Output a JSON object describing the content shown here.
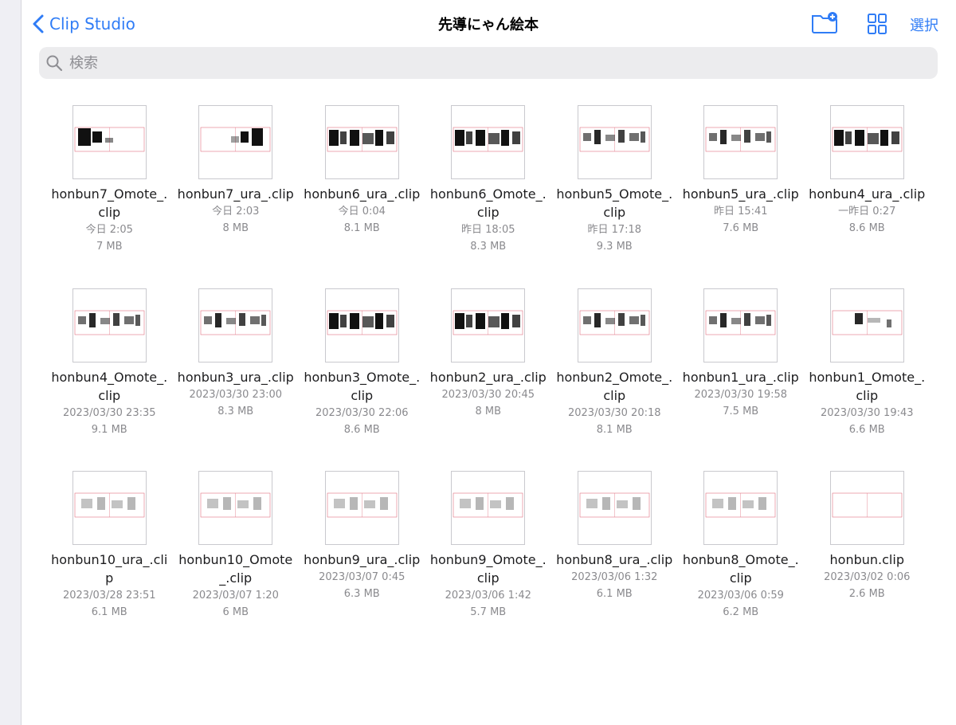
{
  "header": {
    "back_label": "Clip Studio",
    "title": "先導にゃん絵本",
    "select_label": "選択"
  },
  "search": {
    "placeholder": "検索",
    "value": ""
  },
  "files": [
    {
      "name": "honbun7_Omote_.clip",
      "date": "今日 2:05",
      "size": "7 MB",
      "thumb": "dark-left"
    },
    {
      "name": "honbun7_ura_.clip",
      "date": "今日 2:03",
      "size": "8 MB",
      "thumb": "dark-right"
    },
    {
      "name": "honbun6_ura_.clip",
      "date": "今日 0:04",
      "size": "8.1 MB",
      "thumb": "dense"
    },
    {
      "name": "honbun6_Omote_.clip",
      "date": "昨日 18:05",
      "size": "8.3 MB",
      "thumb": "dense"
    },
    {
      "name": "honbun5_Omote_.clip",
      "date": "昨日 17:18",
      "size": "9.3 MB",
      "thumb": "medium"
    },
    {
      "name": "honbun5_ura_.clip",
      "date": "昨日 15:41",
      "size": "7.6 MB",
      "thumb": "medium"
    },
    {
      "name": "honbun4_ura_.clip",
      "date": "一昨日 0:27",
      "size": "8.6 MB",
      "thumb": "dense"
    },
    {
      "name": "honbun4_Omote_.clip",
      "date": "2023/03/30 23:35",
      "size": "9.1 MB",
      "thumb": "medium"
    },
    {
      "name": "honbun3_ura_.clip",
      "date": "2023/03/30 23:00",
      "size": "8.3 MB",
      "thumb": "medium"
    },
    {
      "name": "honbun3_Omote_.clip",
      "date": "2023/03/30 22:06",
      "size": "8.6 MB",
      "thumb": "dense"
    },
    {
      "name": "honbun2_ura_.clip",
      "date": "2023/03/30 20:45",
      "size": "8 MB",
      "thumb": "dense"
    },
    {
      "name": "honbun2_Omote_.clip",
      "date": "2023/03/30 20:18",
      "size": "8.1 MB",
      "thumb": "medium"
    },
    {
      "name": "honbun1_ura_.clip",
      "date": "2023/03/30 19:58",
      "size": "7.5 MB",
      "thumb": "medium"
    },
    {
      "name": "honbun1_Omote_.clip",
      "date": "2023/03/30 19:43",
      "size": "6.6 MB",
      "thumb": "light"
    },
    {
      "name": "honbun10_ura_.clip",
      "date": "2023/03/28 23:51",
      "size": "6.1 MB",
      "thumb": "sketch"
    },
    {
      "name": "honbun10_Omote_.clip",
      "date": "2023/03/07 1:20",
      "size": "6 MB",
      "thumb": "sketch"
    },
    {
      "name": "honbun9_ura_.clip",
      "date": "2023/03/07 0:45",
      "size": "6.3 MB",
      "thumb": "sketch"
    },
    {
      "name": "honbun9_Omote_.clip",
      "date": "2023/03/06 1:42",
      "size": "5.7 MB",
      "thumb": "sketch"
    },
    {
      "name": "honbun8_ura_.clip",
      "date": "2023/03/06 1:32",
      "size": "6.1 MB",
      "thumb": "sketch"
    },
    {
      "name": "honbun8_Omote_.clip",
      "date": "2023/03/06 0:59",
      "size": "6.2 MB",
      "thumb": "sketch"
    },
    {
      "name": "honbun.clip",
      "date": "2023/03/02 0:06",
      "size": "2.6 MB",
      "thumb": "blank"
    }
  ],
  "colors": {
    "accent": "#2f7cf6",
    "guide": "#e07080"
  },
  "icons": {
    "back": "chevron-left-icon",
    "new_folder": "folder-plus-icon",
    "view": "grid-view-icon",
    "search": "magnifier-icon"
  }
}
